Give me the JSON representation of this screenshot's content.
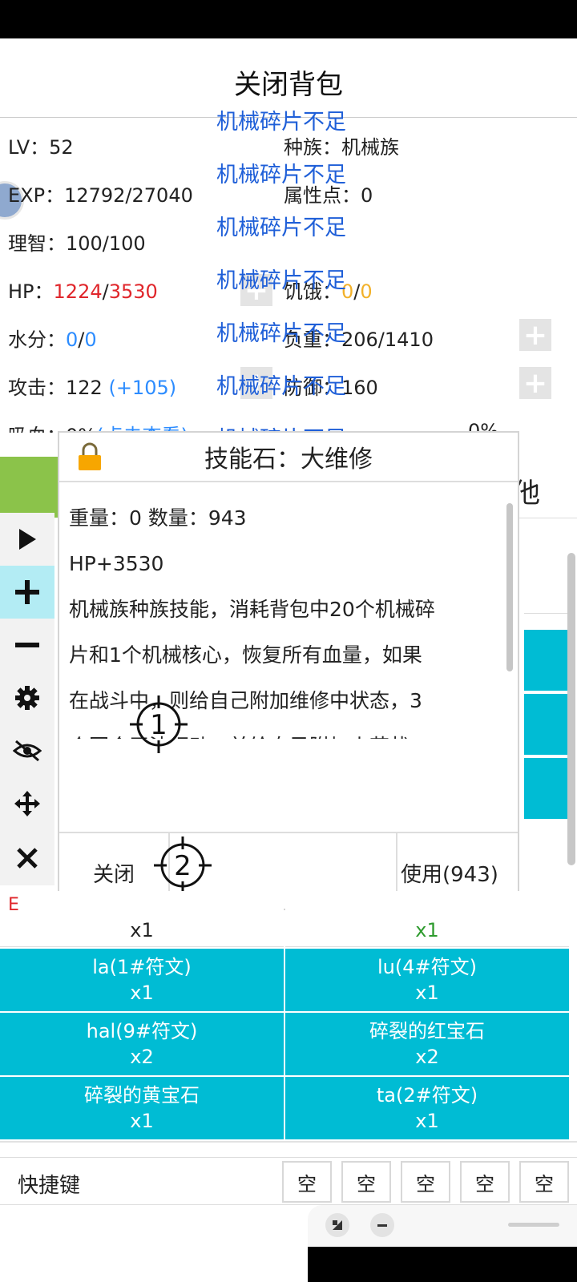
{
  "header": {
    "title": "关闭背包"
  },
  "stats": {
    "lv": {
      "label": "LV：",
      "value": "52"
    },
    "race": {
      "label": "种族：",
      "value": "机械族"
    },
    "exp": {
      "label": "EXP：",
      "value": "12792/27040"
    },
    "attr_points": {
      "label": "属性点：",
      "value": "0"
    },
    "sanity": {
      "label": "理智：",
      "value": "100/100"
    },
    "hp": {
      "label": "HP：",
      "current": "1224",
      "sep": "/",
      "max": "3530"
    },
    "hunger": {
      "label": "饥饿：",
      "current": "0",
      "sep": "/",
      "max": "0"
    },
    "water": {
      "label": "水分：",
      "current": "0",
      "sep": "/",
      "max": "0"
    },
    "load": {
      "label": "负重：",
      "value": "206/1410"
    },
    "attack": {
      "label": "攻击：",
      "value": "122",
      "bonus": "(+105)"
    },
    "defense": {
      "label": "防御：",
      "value": "160"
    },
    "lifesteal": {
      "label": "吸血：",
      "value": "0%",
      "link": "(点击查看)"
    },
    "dodge_partial": {
      "value": "0%"
    }
  },
  "float_messages": [
    "机械碎片不足",
    "机械碎片不足",
    "机械碎片不足",
    "机械碎片不足",
    "机械碎片不足",
    "机械碎片不足",
    "机械碎片不足"
  ],
  "tabs": {
    "right_partial": "他"
  },
  "dialog": {
    "title": "技能石：大维修",
    "weight_line": "重量：0  数量：943",
    "effect": "HP+3530",
    "desc_lines": [
      "机械族种族技能，消耗背包中20个机械碎",
      "片和1个机械核心，恢复所有血量，如果",
      "在战斗中，则给自己附加维修中状态，3",
      "个回合无法行动，并给自己附加火花状"
    ],
    "close_label": "关闭",
    "use_label": "使用(943)"
  },
  "markers": {
    "m1": "1",
    "m2": "2"
  },
  "inventory": {
    "partial_row": {
      "left_tag": "E",
      "left_qty": "x1",
      "right_qty": "x1"
    },
    "rows": [
      {
        "left": {
          "name": "la(1#符文)",
          "qty": "x1"
        },
        "right": {
          "name": "lu(4#符文)",
          "qty": "x1"
        }
      },
      {
        "left": {
          "name": "hal(9#符文)",
          "qty": "x2"
        },
        "right": {
          "name": "碎裂的红宝石",
          "qty": "x2"
        }
      },
      {
        "left": {
          "name": "碎裂的黄宝石",
          "qty": "x1"
        },
        "right": {
          "name": "ta(2#符文)",
          "qty": "x1"
        }
      }
    ]
  },
  "quickbar": {
    "label": "快捷键",
    "slots": [
      "空",
      "空",
      "空",
      "空",
      "空"
    ]
  },
  "icons": {
    "play": "play-icon",
    "plus": "plus-icon",
    "minus": "minus-icon",
    "gear": "gear-icon",
    "eye_off": "eye-off-icon",
    "move": "move-icon",
    "close": "close-icon",
    "lock": "lock-icon"
  },
  "colors": {
    "accent_cyan": "#00bcd4",
    "tab_green": "#8bc34a",
    "hp_red": "#e0262b",
    "msg_blue": "#1f5fd8"
  }
}
